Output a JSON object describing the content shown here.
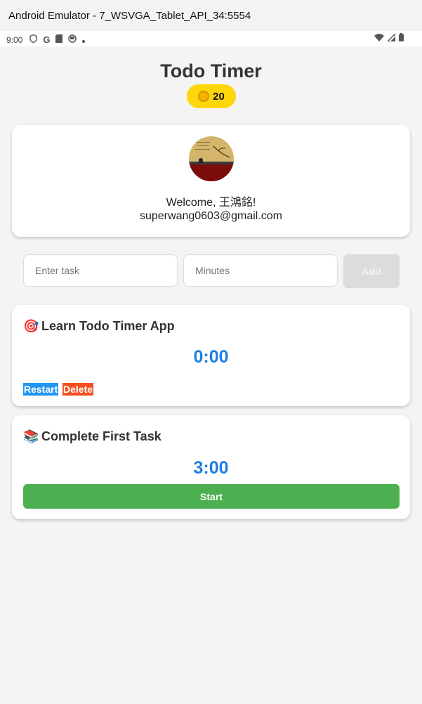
{
  "window": {
    "title": "Android Emulator - 7_WSVGA_Tablet_API_34:5554"
  },
  "statusbar": {
    "time": "9:00",
    "icons": [
      "shield-icon",
      "google-icon",
      "sd-card-icon",
      "notification-icon",
      "dot-icon",
      "wifi-icon",
      "signal-icon",
      "battery-icon"
    ]
  },
  "app": {
    "title": "Todo Timer",
    "coins": "20",
    "profile": {
      "welcome": "Welcome, 王鴻銘!",
      "email": "superwang0603@gmail.com"
    },
    "form": {
      "task_placeholder": "Enter task",
      "minutes_placeholder": "Minutes",
      "add_label": "Add"
    },
    "tasks": [
      {
        "emoji": "🎯",
        "title": "Learn Todo Timer App",
        "timer": "0:00",
        "restart_label": "Restart",
        "delete_label": "Delete"
      },
      {
        "emoji": "📚",
        "title": "Complete First Task",
        "timer": "3:00",
        "start_label": "Start"
      }
    ]
  },
  "colors": {
    "accent_blue": "#1e7fe0",
    "coin_yellow": "#ffd60a",
    "start_green": "#4caf50",
    "restart_blue": "#2196f3",
    "delete_orange": "#f4511e"
  }
}
